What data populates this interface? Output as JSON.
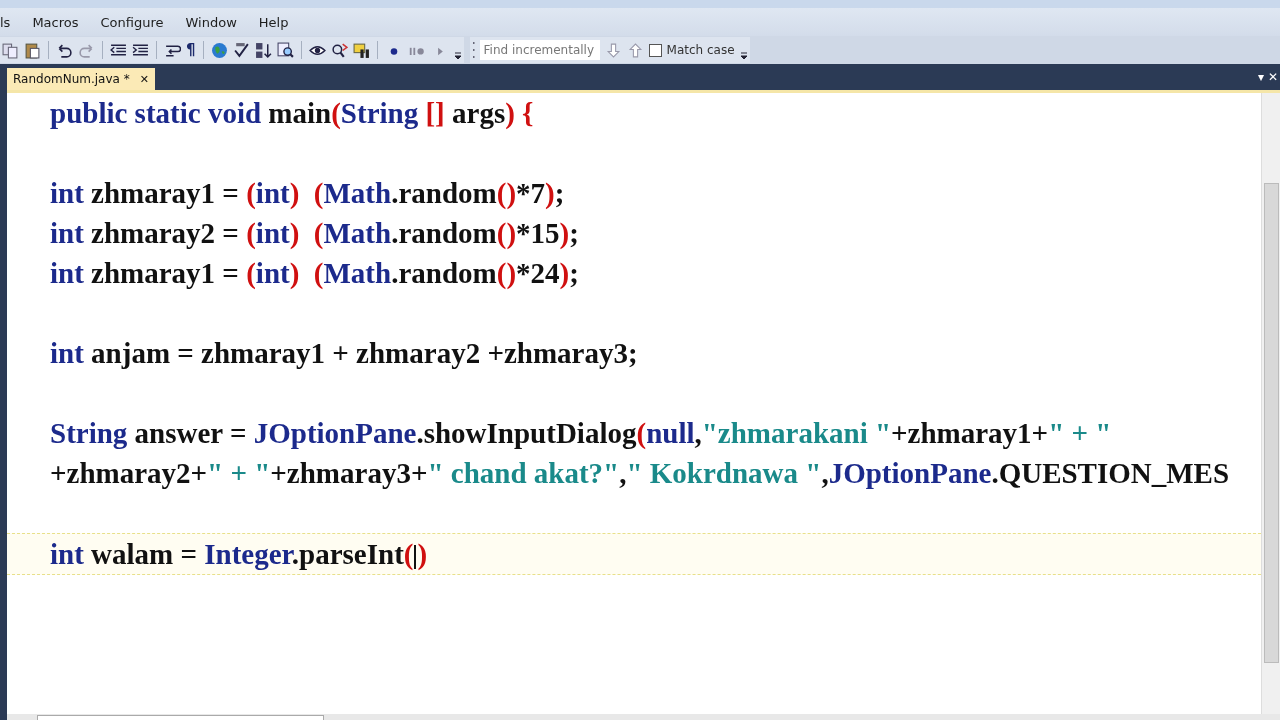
{
  "menu": [
    "ls",
    "Macros",
    "Configure",
    "Window",
    "Help"
  ],
  "toolbar": {
    "pilcrow": "¶",
    "find": {
      "placeholder": "Find incrementally"
    },
    "match_case": {
      "label": "Match case",
      "checked": false
    }
  },
  "tabs": [
    {
      "label": "RandomNum.java *",
      "close": "✕",
      "selected": true
    }
  ],
  "tab_strip_controls": [
    "▾",
    "✕"
  ],
  "code_lines": [
    {
      "current": false,
      "tokens": [
        {
          "kind": "keyword",
          "text": "public static void "
        },
        {
          "kind": "plain",
          "text": "main"
        },
        {
          "kind": "paren",
          "text": "("
        },
        {
          "kind": "keyword",
          "text": "String "
        },
        {
          "kind": "paren",
          "text": "[]"
        },
        {
          "kind": "plain",
          "text": " args"
        },
        {
          "kind": "paren",
          "text": ") {"
        }
      ]
    },
    {
      "current": false
    },
    {
      "current": false,
      "tokens": [
        {
          "kind": "keyword",
          "text": "int "
        },
        {
          "kind": "plain",
          "text": "zhmaray1 = "
        },
        {
          "kind": "paren",
          "text": "("
        },
        {
          "kind": "keyword",
          "text": "int"
        },
        {
          "kind": "paren",
          "text": ")  ("
        },
        {
          "kind": "keyword",
          "text": "Math"
        },
        {
          "kind": "plain",
          "text": ".random"
        },
        {
          "kind": "paren",
          "text": "()"
        },
        {
          "kind": "plain",
          "text": "*7"
        },
        {
          "kind": "paren",
          "text": ")"
        },
        {
          "kind": "plain",
          "text": ";"
        }
      ]
    },
    {
      "current": false,
      "tokens": [
        {
          "kind": "keyword",
          "text": "int "
        },
        {
          "kind": "plain",
          "text": "zhmaray2 = "
        },
        {
          "kind": "paren",
          "text": "("
        },
        {
          "kind": "keyword",
          "text": "int"
        },
        {
          "kind": "paren",
          "text": ")  ("
        },
        {
          "kind": "keyword",
          "text": "Math"
        },
        {
          "kind": "plain",
          "text": ".random"
        },
        {
          "kind": "paren",
          "text": "()"
        },
        {
          "kind": "plain",
          "text": "*15"
        },
        {
          "kind": "paren",
          "text": ")"
        },
        {
          "kind": "plain",
          "text": ";"
        }
      ]
    },
    {
      "current": false,
      "tokens": [
        {
          "kind": "keyword",
          "text": "int "
        },
        {
          "kind": "plain",
          "text": "zhmaray1 = "
        },
        {
          "kind": "paren",
          "text": "("
        },
        {
          "kind": "keyword",
          "text": "int"
        },
        {
          "kind": "paren",
          "text": ")  ("
        },
        {
          "kind": "keyword",
          "text": "Math"
        },
        {
          "kind": "plain",
          "text": ".random"
        },
        {
          "kind": "paren",
          "text": "()"
        },
        {
          "kind": "plain",
          "text": "*24"
        },
        {
          "kind": "paren",
          "text": ")"
        },
        {
          "kind": "plain",
          "text": ";"
        }
      ]
    },
    {
      "current": false
    },
    {
      "current": false,
      "tokens": [
        {
          "kind": "keyword",
          "text": "int "
        },
        {
          "kind": "plain",
          "text": "anjam = zhmaray1 + zhmaray2 +zhmaray3;"
        }
      ]
    },
    {
      "current": false
    },
    {
      "current": false,
      "tokens": [
        {
          "kind": "keyword",
          "text": "String "
        },
        {
          "kind": "plain",
          "text": "answer = "
        },
        {
          "kind": "keyword",
          "text": "JOptionPane"
        },
        {
          "kind": "plain",
          "text": ".showInputDialog"
        },
        {
          "kind": "paren",
          "text": "("
        },
        {
          "kind": "keyword",
          "text": "null"
        },
        {
          "kind": "plain",
          "text": ","
        },
        {
          "kind": "string",
          "text": "\"zhmarakani \""
        },
        {
          "kind": "plain",
          "text": "+zhmaray1+"
        },
        {
          "kind": "string",
          "text": "\" + \""
        }
      ]
    },
    {
      "current": false,
      "tokens": [
        {
          "kind": "plain",
          "text": "+zhmaray2+"
        },
        {
          "kind": "string",
          "text": "\" + \""
        },
        {
          "kind": "plain",
          "text": "+zhmaray3+"
        },
        {
          "kind": "string",
          "text": "\" chand akat?\""
        },
        {
          "kind": "plain",
          "text": ","
        },
        {
          "kind": "string",
          "text": "\" Kokrdnawa \""
        },
        {
          "kind": "plain",
          "text": ","
        },
        {
          "kind": "keyword",
          "text": "JOptionPane"
        },
        {
          "kind": "plain",
          "text": ".QUESTION_MES"
        }
      ]
    },
    {
      "current": false
    },
    {
      "current": true,
      "tokens": [
        {
          "kind": "keyword",
          "text": "int "
        },
        {
          "kind": "plain",
          "text": "walam = "
        },
        {
          "kind": "keyword",
          "text": "Integer"
        },
        {
          "kind": "plain",
          "text": ".parseInt"
        },
        {
          "kind": "paren",
          "text": "(",
          "caret": true
        },
        {
          "kind": "paren",
          "text": ")"
        }
      ]
    }
  ]
}
